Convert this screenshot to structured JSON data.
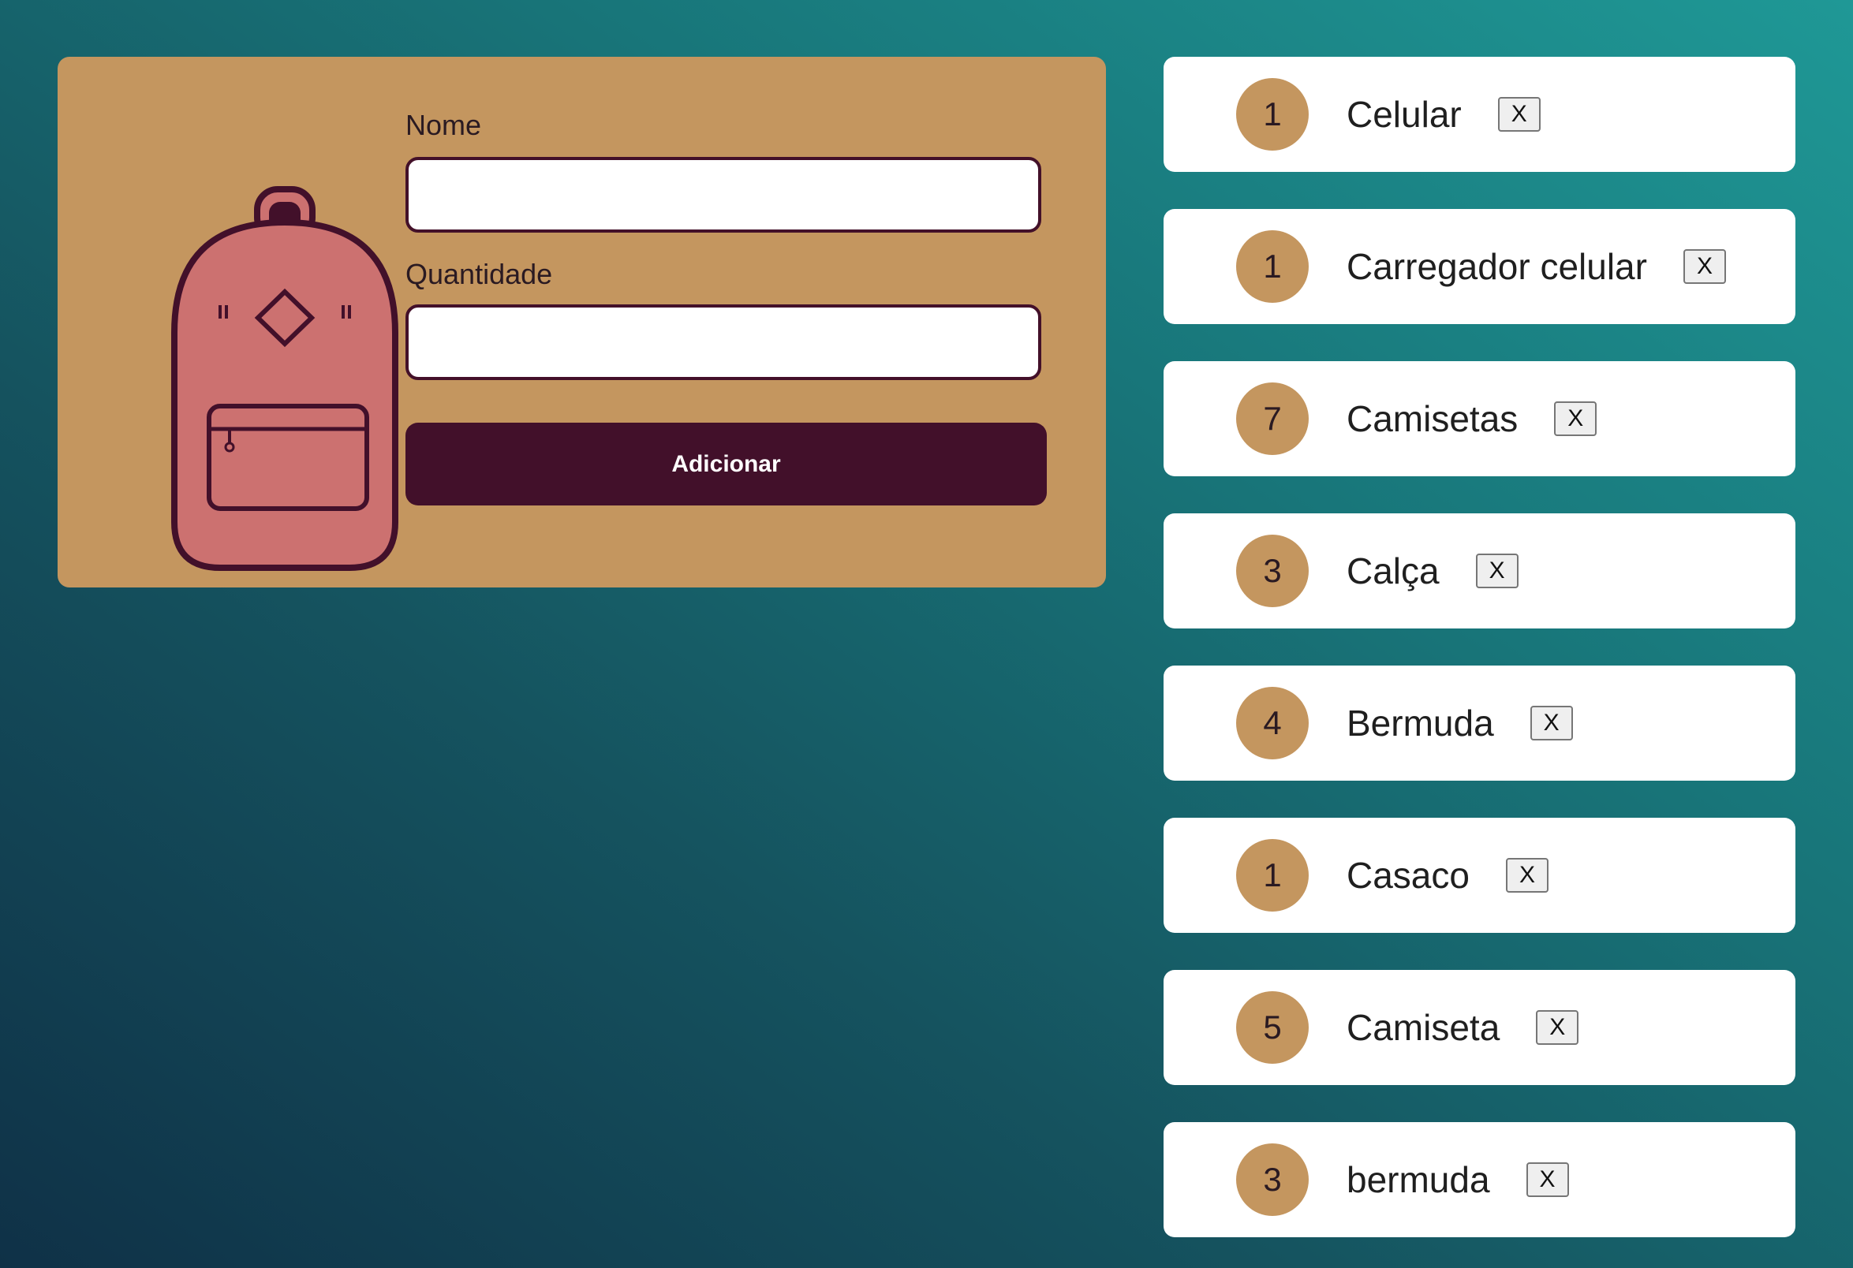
{
  "form": {
    "name_label": "Nome",
    "quantity_label": "Quantidade",
    "name_value": "",
    "quantity_value": "",
    "submit_label": "Adicionar"
  },
  "colors": {
    "background_start": "#0f3147",
    "background_end": "#1f9896",
    "card": "#c4965f",
    "accent_dark": "#42102a",
    "backpack_fill": "#cc7170"
  },
  "icons": {
    "illustration": "backpack-icon",
    "remove": "close-icon"
  },
  "items": [
    {
      "quantity": "1",
      "name": "Celular",
      "remove_label": "X"
    },
    {
      "quantity": "1",
      "name": "Carregador celular",
      "remove_label": "X"
    },
    {
      "quantity": "7",
      "name": "Camisetas",
      "remove_label": "X"
    },
    {
      "quantity": "3",
      "name": "Calça",
      "remove_label": "X"
    },
    {
      "quantity": "4",
      "name": "Bermuda",
      "remove_label": "X"
    },
    {
      "quantity": "1",
      "name": "Casaco",
      "remove_label": "X"
    },
    {
      "quantity": "5",
      "name": "Camiseta",
      "remove_label": "X"
    },
    {
      "quantity": "3",
      "name": "bermuda",
      "remove_label": "X"
    }
  ]
}
